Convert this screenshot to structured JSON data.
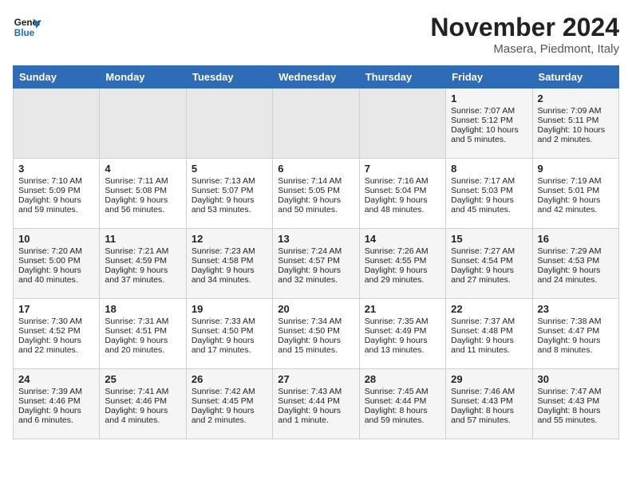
{
  "logo": {
    "line1": "General",
    "line2": "Blue"
  },
  "title": "November 2024",
  "subtitle": "Masera, Piedmont, Italy",
  "headers": [
    "Sunday",
    "Monday",
    "Tuesday",
    "Wednesday",
    "Thursday",
    "Friday",
    "Saturday"
  ],
  "rows": [
    [
      {
        "day": "",
        "content": ""
      },
      {
        "day": "",
        "content": ""
      },
      {
        "day": "",
        "content": ""
      },
      {
        "day": "",
        "content": ""
      },
      {
        "day": "",
        "content": ""
      },
      {
        "day": "1",
        "content": "Sunrise: 7:07 AM\nSunset: 5:12 PM\nDaylight: 10 hours and 5 minutes."
      },
      {
        "day": "2",
        "content": "Sunrise: 7:09 AM\nSunset: 5:11 PM\nDaylight: 10 hours and 2 minutes."
      }
    ],
    [
      {
        "day": "3",
        "content": "Sunrise: 7:10 AM\nSunset: 5:09 PM\nDaylight: 9 hours and 59 minutes."
      },
      {
        "day": "4",
        "content": "Sunrise: 7:11 AM\nSunset: 5:08 PM\nDaylight: 9 hours and 56 minutes."
      },
      {
        "day": "5",
        "content": "Sunrise: 7:13 AM\nSunset: 5:07 PM\nDaylight: 9 hours and 53 minutes."
      },
      {
        "day": "6",
        "content": "Sunrise: 7:14 AM\nSunset: 5:05 PM\nDaylight: 9 hours and 50 minutes."
      },
      {
        "day": "7",
        "content": "Sunrise: 7:16 AM\nSunset: 5:04 PM\nDaylight: 9 hours and 48 minutes."
      },
      {
        "day": "8",
        "content": "Sunrise: 7:17 AM\nSunset: 5:03 PM\nDaylight: 9 hours and 45 minutes."
      },
      {
        "day": "9",
        "content": "Sunrise: 7:19 AM\nSunset: 5:01 PM\nDaylight: 9 hours and 42 minutes."
      }
    ],
    [
      {
        "day": "10",
        "content": "Sunrise: 7:20 AM\nSunset: 5:00 PM\nDaylight: 9 hours and 40 minutes."
      },
      {
        "day": "11",
        "content": "Sunrise: 7:21 AM\nSunset: 4:59 PM\nDaylight: 9 hours and 37 minutes."
      },
      {
        "day": "12",
        "content": "Sunrise: 7:23 AM\nSunset: 4:58 PM\nDaylight: 9 hours and 34 minutes."
      },
      {
        "day": "13",
        "content": "Sunrise: 7:24 AM\nSunset: 4:57 PM\nDaylight: 9 hours and 32 minutes."
      },
      {
        "day": "14",
        "content": "Sunrise: 7:26 AM\nSunset: 4:55 PM\nDaylight: 9 hours and 29 minutes."
      },
      {
        "day": "15",
        "content": "Sunrise: 7:27 AM\nSunset: 4:54 PM\nDaylight: 9 hours and 27 minutes."
      },
      {
        "day": "16",
        "content": "Sunrise: 7:29 AM\nSunset: 4:53 PM\nDaylight: 9 hours and 24 minutes."
      }
    ],
    [
      {
        "day": "17",
        "content": "Sunrise: 7:30 AM\nSunset: 4:52 PM\nDaylight: 9 hours and 22 minutes."
      },
      {
        "day": "18",
        "content": "Sunrise: 7:31 AM\nSunset: 4:51 PM\nDaylight: 9 hours and 20 minutes."
      },
      {
        "day": "19",
        "content": "Sunrise: 7:33 AM\nSunset: 4:50 PM\nDaylight: 9 hours and 17 minutes."
      },
      {
        "day": "20",
        "content": "Sunrise: 7:34 AM\nSunset: 4:50 PM\nDaylight: 9 hours and 15 minutes."
      },
      {
        "day": "21",
        "content": "Sunrise: 7:35 AM\nSunset: 4:49 PM\nDaylight: 9 hours and 13 minutes."
      },
      {
        "day": "22",
        "content": "Sunrise: 7:37 AM\nSunset: 4:48 PM\nDaylight: 9 hours and 11 minutes."
      },
      {
        "day": "23",
        "content": "Sunrise: 7:38 AM\nSunset: 4:47 PM\nDaylight: 9 hours and 8 minutes."
      }
    ],
    [
      {
        "day": "24",
        "content": "Sunrise: 7:39 AM\nSunset: 4:46 PM\nDaylight: 9 hours and 6 minutes."
      },
      {
        "day": "25",
        "content": "Sunrise: 7:41 AM\nSunset: 4:46 PM\nDaylight: 9 hours and 4 minutes."
      },
      {
        "day": "26",
        "content": "Sunrise: 7:42 AM\nSunset: 4:45 PM\nDaylight: 9 hours and 2 minutes."
      },
      {
        "day": "27",
        "content": "Sunrise: 7:43 AM\nSunset: 4:44 PM\nDaylight: 9 hours and 1 minute."
      },
      {
        "day": "28",
        "content": "Sunrise: 7:45 AM\nSunset: 4:44 PM\nDaylight: 8 hours and 59 minutes."
      },
      {
        "day": "29",
        "content": "Sunrise: 7:46 AM\nSunset: 4:43 PM\nDaylight: 8 hours and 57 minutes."
      },
      {
        "day": "30",
        "content": "Sunrise: 7:47 AM\nSunset: 4:43 PM\nDaylight: 8 hours and 55 minutes."
      }
    ]
  ]
}
